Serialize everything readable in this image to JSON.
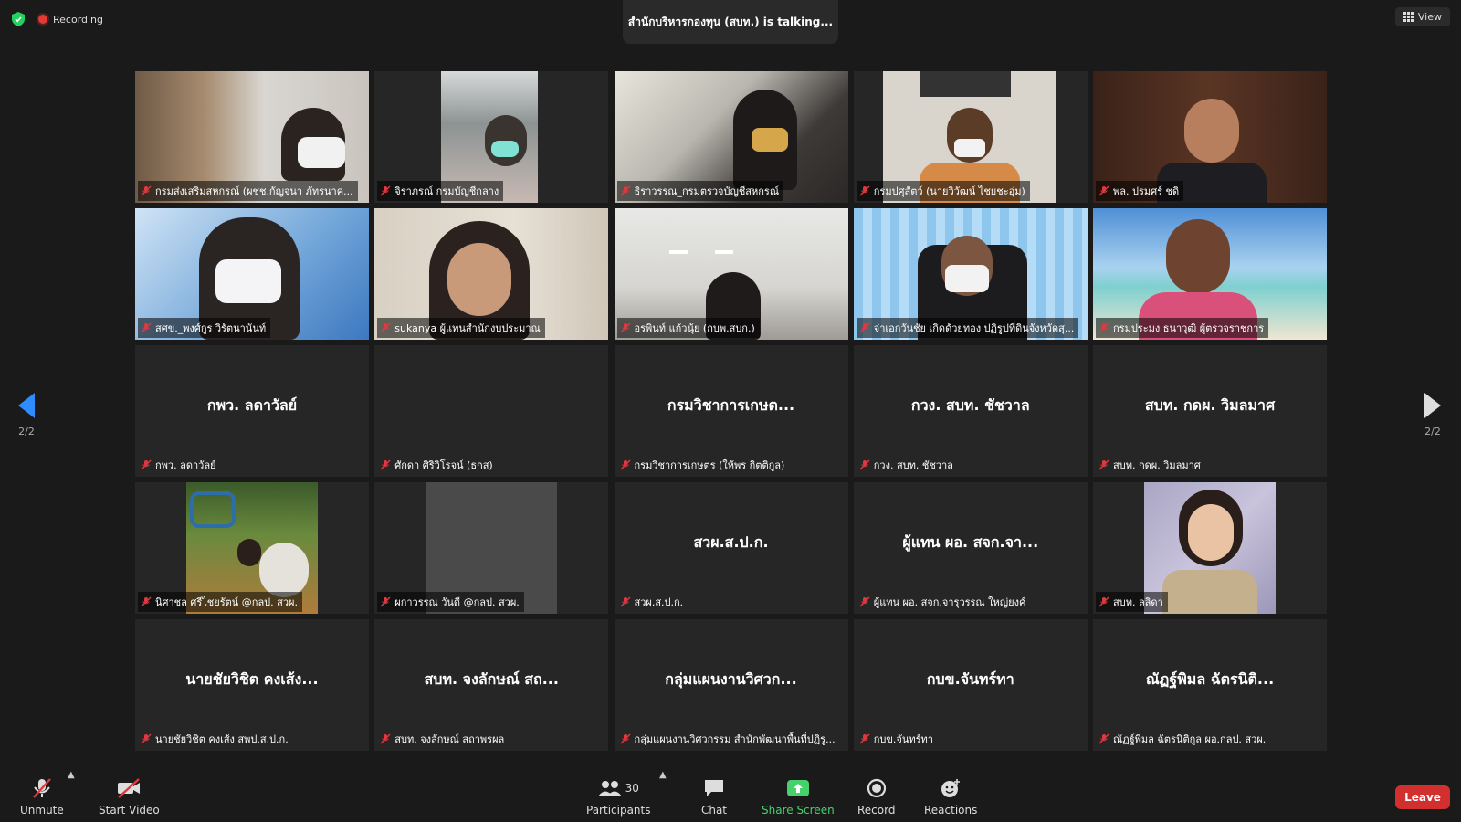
{
  "top": {
    "recording_label": "Recording",
    "talking_text": "สำนักบริหารกองทุน (สบท.) is  talking...",
    "view_label": "View"
  },
  "pager": {
    "left_label": "2/2",
    "right_label": "2/2"
  },
  "tiles": [
    {
      "label": "กรมส่งเสริมสหกรณ์ (ผชช.กัญจนา ภัทรนาค...",
      "big_name": ""
    },
    {
      "label": "จิราภรณ์ กรมบัญชีกลาง",
      "big_name": ""
    },
    {
      "label": "ธิราวรรณ_กรมตรวจบัญชีสหกรณ์",
      "big_name": ""
    },
    {
      "label": "กรมปศุสัตว์ (นายวิวัฒน์ ไชยชะอุ่ม)",
      "big_name": ""
    },
    {
      "label": "พล. ปรมศร์ ชดิ",
      "big_name": ""
    },
    {
      "label": "สศข._พงศ์กูร วิรัตนานันท์",
      "big_name": ""
    },
    {
      "label": "sukanya ผู้แทนสำนักงบประมาณ",
      "big_name": ""
    },
    {
      "label": "อรพินท์ แก้วนุ้ย (กบพ.สบก.)",
      "big_name": ""
    },
    {
      "label": "จ่าเอกวันชัย  เกิดด้วยทอง ปฏิรูปที่ดินจังหวัดสุ...",
      "big_name": ""
    },
    {
      "label": "กรมประมง ธนาวุฒิ ผู้ตรวจราชการ",
      "big_name": ""
    },
    {
      "label": "กพว. ลดาวัลย์",
      "big_name": "กพว. ลดาวัลย์"
    },
    {
      "label": "ศักดา ศิริวิโรจน์ (ธกส)",
      "big_name": ""
    },
    {
      "label": "กรมวิชาการเกษตร (ให้พร กิตติกูล)",
      "big_name": "กรมวิชาการเกษต..."
    },
    {
      "label": "กวง. สบท. ชัชวาล",
      "big_name": "กวง. สบท. ชัชวาล"
    },
    {
      "label": "สบท. กดผ. วิมลมาศ",
      "big_name": "สบท. กดผ. วิมลมาศ"
    },
    {
      "label": "นิศาชล ศรีไชยรัตน์ @กลป. สวผ.",
      "big_name": ""
    },
    {
      "label": "ผกาวรรณ วันดี @กลป. สวผ.",
      "big_name": ""
    },
    {
      "label": "สวผ.ส.ป.ก.",
      "big_name": "สวผ.ส.ป.ก."
    },
    {
      "label": "ผู้แทน ผอ. สจก.จารุวรรณ ใหญ่ยงค์",
      "big_name": "ผู้แทน ผอ. สจก.จา..."
    },
    {
      "label": "สบท. ลลิดา",
      "big_name": ""
    },
    {
      "label": "นายชัยวิชิต  คงเส้ง สพป.ส.ป.ก.",
      "big_name": "นายชัยวิชิต  คงเส้ง..."
    },
    {
      "label": "สบท. จงลักษณ์ สถาพรผล",
      "big_name": "สบท. จงลักษณ์ สถ..."
    },
    {
      "label": "กลุ่มแผนงานวิศวกรรม สำนักพัฒนาพื้นที่ปฏิรู...",
      "big_name": "กลุ่มแผนงานวิศวก..."
    },
    {
      "label": "กบข.จันทร์ทา",
      "big_name": "กบข.จันทร์ทา"
    },
    {
      "label": "ณัฏฐ์พิมล ฉัตรนิติกูล ผอ.กลป. สวผ.",
      "big_name": "ณัฏฐ์พิมล ฉัตรนิติ..."
    }
  ],
  "toolbar": {
    "unmute_label": "Unmute",
    "start_video_label": "Start Video",
    "participants_count": "30",
    "participants_label": "Participants",
    "chat_label": "Chat",
    "share_screen_label": "Share Screen",
    "record_label": "Record",
    "reactions_label": "Reactions",
    "leave_label": "Leave"
  },
  "colors": {
    "accent": "#2d8cff",
    "share_green": "#47d16c",
    "leave_red": "#d22f2f",
    "muted_red": "#e0383e"
  }
}
